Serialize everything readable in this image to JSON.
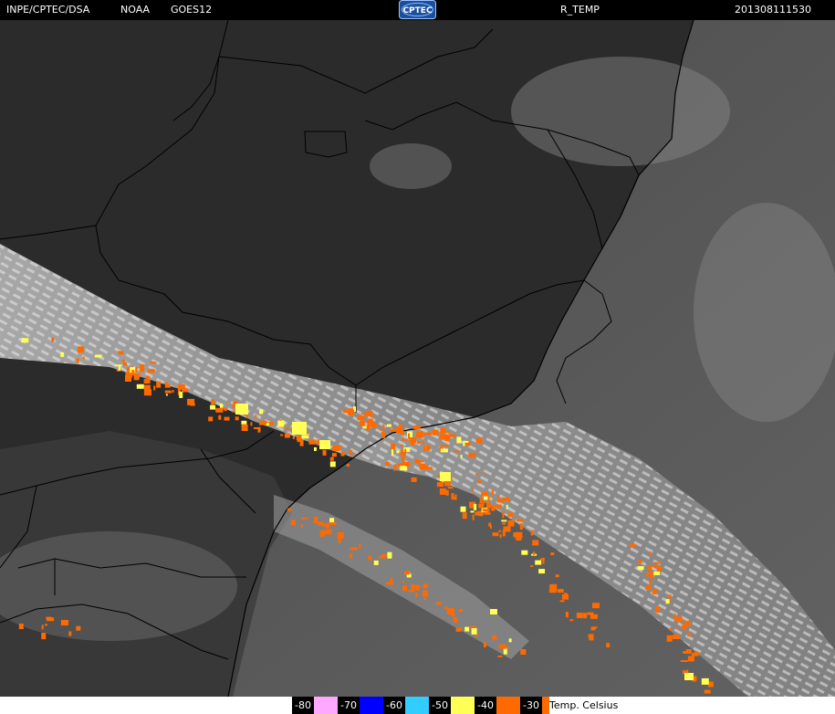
{
  "header": {
    "source": "INPE/CPTEC/DSA",
    "agency": "NOAA",
    "satellite": "GOES12",
    "logo_text": "CPTEC",
    "product": "R_TEMP",
    "timestamp": "201308111530"
  },
  "legend": {
    "items": [
      {
        "label": "-80",
        "color": "#ffa8ff"
      },
      {
        "label": "-70",
        "color": "#0000ff"
      },
      {
        "label": "-60",
        "color": "#33ccff"
      },
      {
        "label": "-50",
        "color": "#ffff55"
      },
      {
        "label": "-40",
        "color": "#ff6a00"
      },
      {
        "label": "-30",
        "color": "#ff6a00"
      }
    ],
    "caption": "Temp. Celsius"
  },
  "colors": {
    "cold_cloud_orange": "#ff6a00",
    "cold_cloud_yellow": "#ffff55",
    "land_dark": "#2a2a2a",
    "ocean_gray": "#5a5a5a",
    "logo_blue": "#1b4f9c"
  }
}
